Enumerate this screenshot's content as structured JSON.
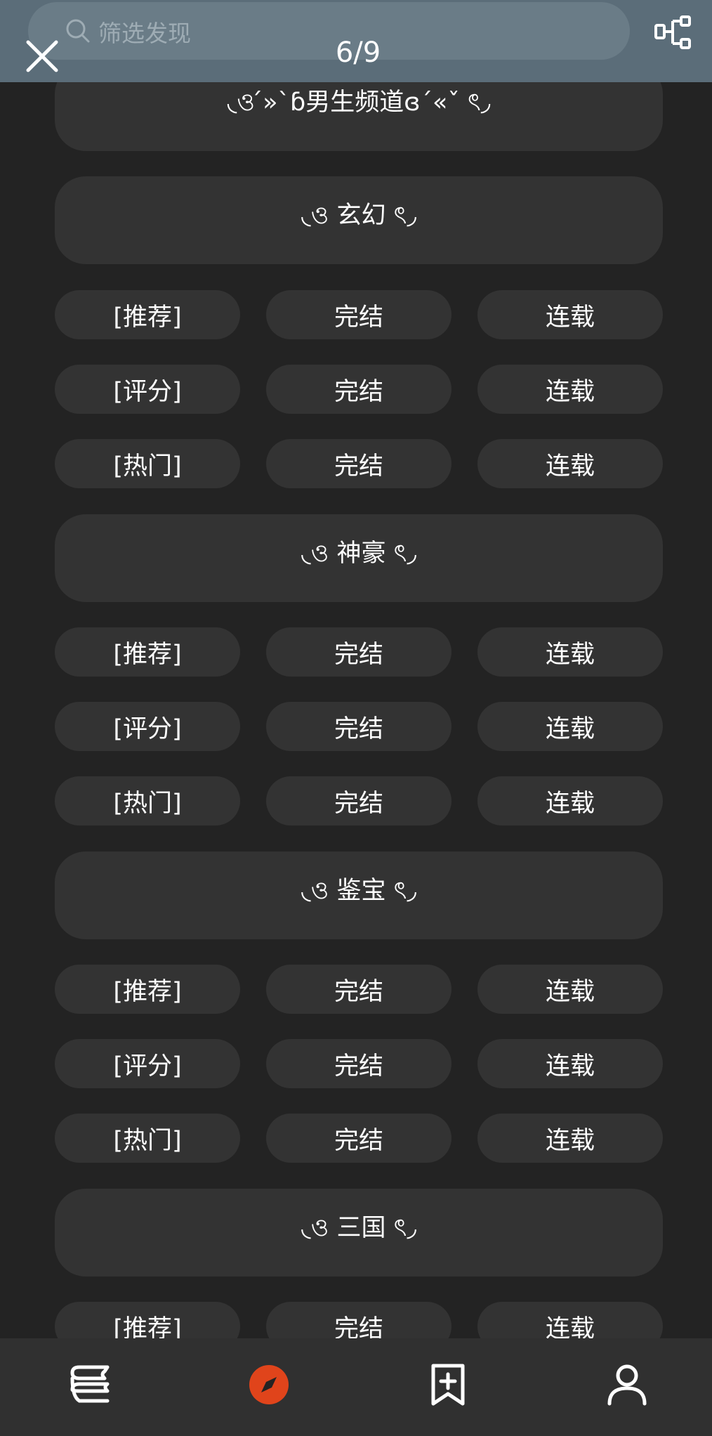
{
  "header": {
    "search_placeholder": "筛选发现",
    "page_counter": "6/9"
  },
  "icons": {
    "search": "search-icon",
    "close": "close-icon",
    "mindmap": "mindmap-icon",
    "bookshelf": "bookshelf-icon",
    "discover": "compass-icon",
    "bookmark": "bookmark-add-icon",
    "profile": "user-icon"
  },
  "colors": {
    "background": "#232323",
    "card": "#333333",
    "topbar": "#5b6d79",
    "accent": "#e0441b"
  },
  "sections": [
    {
      "title": "◟ও ́»`ɓ男生频道ɞ´«ˇ ৎ◞",
      "rows": []
    },
    {
      "title": "◟ও 玄幻 ৎ◞",
      "rows": [
        {
          "label": "[推荐]",
          "done": "完结",
          "ongoing": "连载"
        },
        {
          "label": "[评分]",
          "done": "完结",
          "ongoing": "连载"
        },
        {
          "label": "[热门]",
          "done": "完结",
          "ongoing": "连载"
        }
      ]
    },
    {
      "title": "◟ও 神豪 ৎ◞",
      "rows": [
        {
          "label": "[推荐]",
          "done": "完结",
          "ongoing": "连载"
        },
        {
          "label": "[评分]",
          "done": "完结",
          "ongoing": "连载"
        },
        {
          "label": "[热门]",
          "done": "完结",
          "ongoing": "连载"
        }
      ]
    },
    {
      "title": "◟ও 鉴宝 ৎ◞",
      "rows": [
        {
          "label": "[推荐]",
          "done": "完结",
          "ongoing": "连载"
        },
        {
          "label": "[评分]",
          "done": "完结",
          "ongoing": "连载"
        },
        {
          "label": "[热门]",
          "done": "完结",
          "ongoing": "连载"
        }
      ]
    },
    {
      "title": "◟ও 三国 ৎ◞",
      "rows": [
        {
          "label": "[推荐]",
          "done": "完结",
          "ongoing": "连载"
        }
      ]
    }
  ]
}
